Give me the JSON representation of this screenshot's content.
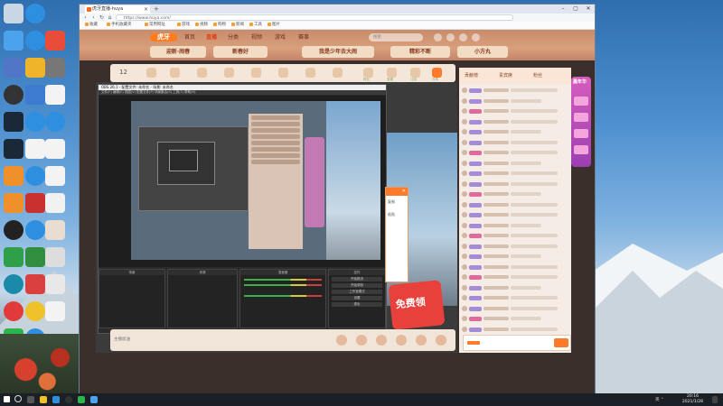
{
  "browser": {
    "tab_title": "虎牙直播-huya",
    "url": "https://www.huya.com/",
    "new_tab": "+",
    "window_controls": [
      "–",
      "▢",
      "✕"
    ],
    "tab_close": "✕",
    "nav": [
      "‹",
      "›",
      "↻",
      "⌂"
    ],
    "bookmarks": [
      "收藏",
      "手机收藏夹",
      "常用网址",
      "游戏",
      "视频",
      "购物",
      "新闻",
      "工具",
      "图片"
    ]
  },
  "huya": {
    "logo": "虎牙",
    "nav": [
      "首页",
      "直播",
      "分类",
      "视频",
      "游戏",
      "赛事"
    ],
    "active_nav": "直播",
    "search_placeholder": "搜索",
    "banners": [
      "迎新·闹春",
      "新春好",
      "我是少年去大闹",
      "精彩不断",
      "小方丸"
    ],
    "room_number": "12",
    "gift_labels": [
      "粉丝",
      "宝箱",
      "订阅",
      "分享",
      "任务"
    ],
    "promo_text": "免费领",
    "bottom_text": "主播加油",
    "overlay_items": [
      "复制",
      "粘贴"
    ]
  },
  "obs": {
    "title": "OBS 26.1 - 配置文件: 未命名 - 场景: 未命名",
    "menu": "文件(F)  编辑(E)  视图(V)  配置文件(P)  场景集合(S)  工具(T)  帮助(H)",
    "panels": [
      "场景",
      "来源",
      "混音器",
      "控件"
    ],
    "controls": [
      "开始推流",
      "开始录制",
      "工作室模式",
      "设置",
      "退出"
    ]
  },
  "chat": {
    "tabs": [
      "贡献榜",
      "贵宾席",
      "粉丝"
    ],
    "message_count": 24
  },
  "side_ad": {
    "title": "嘉年华"
  },
  "taskbar": {
    "time": "20:16",
    "date": "2021/1/28",
    "tray": "英  ⌃"
  },
  "colors": {
    "accent": "#ff7b2a",
    "huya_orange": "#ff7c1f",
    "chat_badge": "#a48cd6",
    "promo_red": "#e8413c"
  },
  "desktop_icons": [
    "recycle-bin-icon",
    "edge-icon",
    "app-icon",
    "folder-icon",
    "steam-icon",
    "edge-icon",
    "file-icon",
    "obs-icon",
    "steam-icon",
    "edge-icon",
    "penguin-icon",
    "document-icon",
    "image-icon",
    "wechat-icon",
    "folder-icon"
  ]
}
